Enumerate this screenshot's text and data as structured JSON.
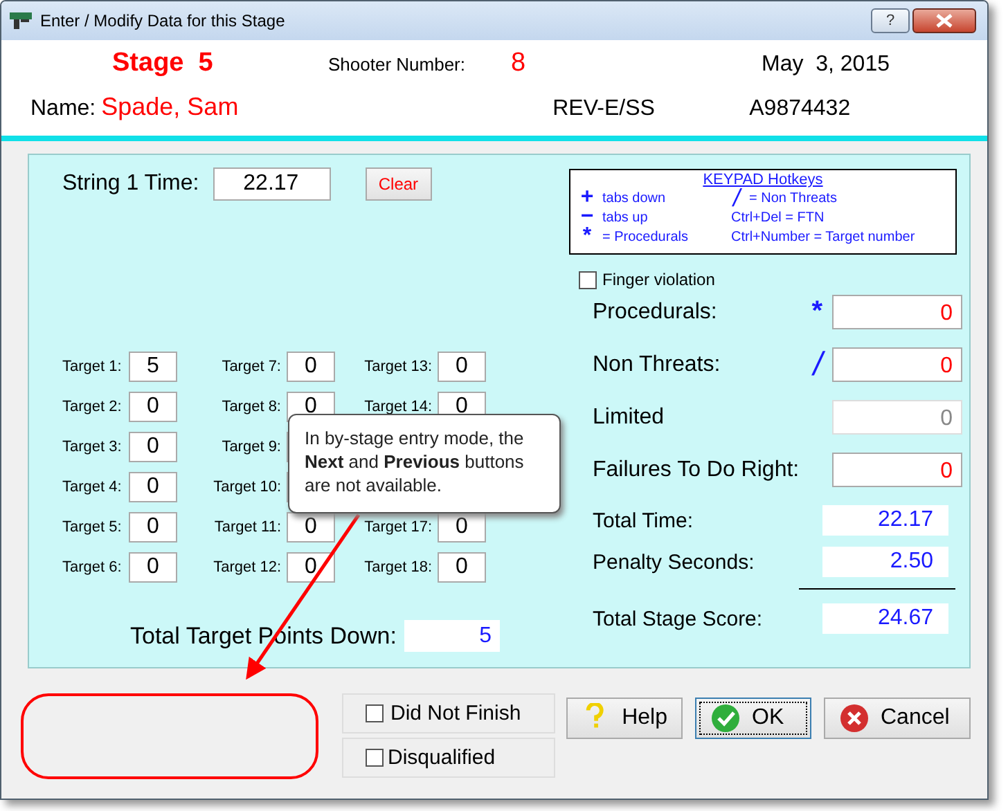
{
  "window": {
    "title": "Enter / Modify Data for this Stage",
    "help_button": "?"
  },
  "header": {
    "stage_label": "Stage",
    "stage_number": "5",
    "shooter_label": "Shooter Number:",
    "shooter_number": "8",
    "date": "May  3, 2015",
    "name_label": "Name:",
    "name": "Spade, Sam",
    "division": "REV-E/SS",
    "member_id": "A9874432"
  },
  "string_time": {
    "label": "String 1 Time:",
    "value": "22.17",
    "clear_button": "Clear"
  },
  "target_rows": [
    [
      {
        "label": "Target 1:",
        "value": "5"
      },
      {
        "label": "Target 7:",
        "value": "0"
      },
      {
        "label": "Target 13:",
        "value": "0"
      }
    ],
    [
      {
        "label": "Target 2:",
        "value": "0"
      },
      {
        "label": "Target 8:",
        "value": "0"
      },
      {
        "label": "Target 14:",
        "value": "0"
      }
    ],
    [
      {
        "label": "Target 3:",
        "value": "0"
      },
      {
        "label": "Target 9:"
      }
    ],
    [
      {
        "label": "Target 4:",
        "value": "0"
      },
      {
        "label": "Target 10:"
      }
    ],
    [
      {
        "label": "Target 5:",
        "value": "0"
      },
      {
        "label": "Target 11:",
        "value": "0"
      },
      {
        "label": "Target 17:",
        "value": "0"
      }
    ],
    [
      {
        "label": "Target 6:",
        "value": "0"
      },
      {
        "label": "Target 12:",
        "value": "0"
      },
      {
        "label": "Target 18:",
        "value": "0"
      }
    ]
  ],
  "target_total": {
    "label": "Total Target Points Down:",
    "value": "5"
  },
  "keypad": {
    "title": "KEYPAD Hotkeys",
    "left": [
      {
        "key": "+",
        "text": "tabs down"
      },
      {
        "key": "−",
        "text": "tabs up"
      },
      {
        "key": "*",
        "text": "= Procedurals"
      }
    ],
    "right": [
      {
        "key": "/",
        "text": "= Non Threats"
      },
      {
        "text": "Ctrl+Del = FTN"
      },
      {
        "text": "Ctrl+Number = Target number"
      }
    ]
  },
  "finger_violation": {
    "label": "Finger violation",
    "checked": false
  },
  "penalties": [
    {
      "label": "Procedurals:",
      "key": "*",
      "value": "0",
      "disabled": false
    },
    {
      "label": "Non Threats:",
      "key": "/",
      "value": "0",
      "disabled": false
    },
    {
      "label": "Limited",
      "value": "0",
      "disabled": true
    },
    {
      "label": "Failures To Do Right:",
      "value": "0",
      "disabled": false
    }
  ],
  "totals": [
    {
      "label": "Total Time:",
      "value": "22.17"
    },
    {
      "label": "Penalty Seconds:",
      "value": "2.50"
    },
    {
      "label": "Total Stage Score:",
      "value": "24.67"
    }
  ],
  "did_not_finish": {
    "label": "Did Not Finish",
    "checked": false
  },
  "disqualified": {
    "label": "Disqualified",
    "checked": false
  },
  "buttons": [
    {
      "kind": "help",
      "label": "Help",
      "focused": false
    },
    {
      "kind": "ok",
      "label": "OK",
      "focused": true
    },
    {
      "kind": "cancel",
      "label": "Cancel",
      "focused": false
    }
  ],
  "callout": {
    "text": "In by-stage entry mode, the **Next** and **Previous** buttons are not available."
  }
}
